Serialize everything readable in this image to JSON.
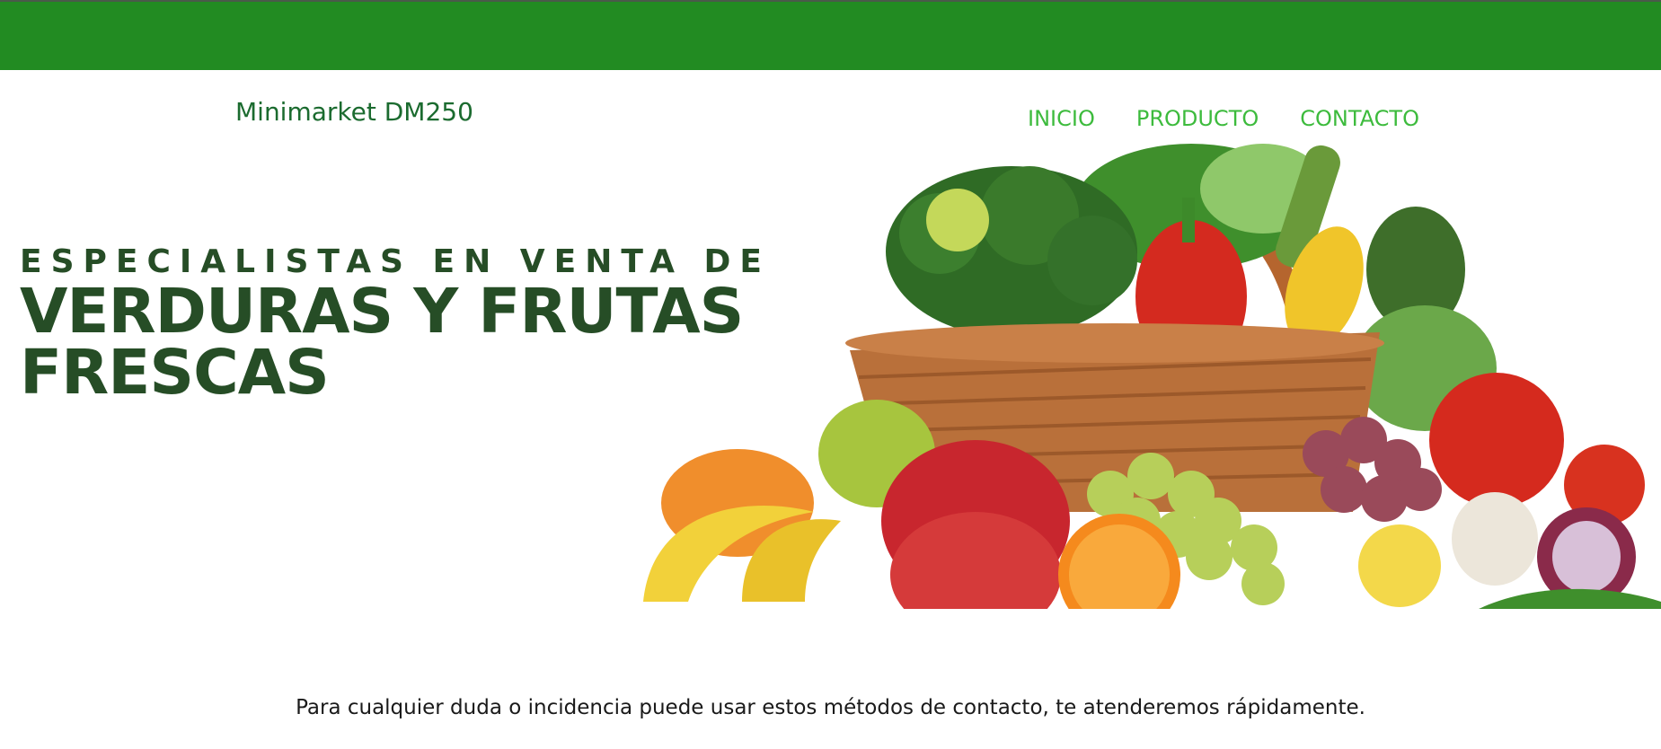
{
  "brand": {
    "name": "Minimarket DM250"
  },
  "nav": {
    "items": [
      "INICIO",
      "PRODUCTO",
      "CONTACTO"
    ]
  },
  "hero": {
    "kicker": "ESPECIALISTAS EN  VENTA DE",
    "headline_line1": "VERDURAS Y FRUTAS",
    "headline_line2": "FRESCAS",
    "image_icon": "fruit-vegetable-basket-image"
  },
  "contact": {
    "note": "Para cualquier duda o incidencia puede usar estos métodos de contacto, te atenderemos rápidamente."
  },
  "colors": {
    "header_bar": "#228b22",
    "brand_text": "#1b6b2f",
    "nav_text": "#3dbb3d",
    "headline_text": "#264d26"
  }
}
